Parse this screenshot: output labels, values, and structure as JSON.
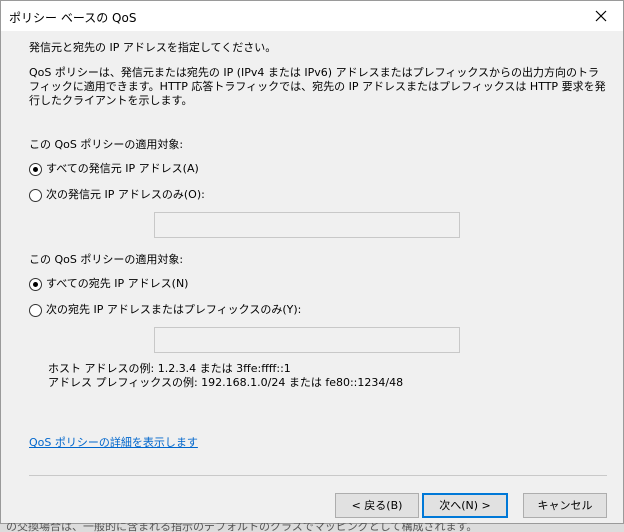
{
  "window": {
    "title": "ポリシー ベースの QoS"
  },
  "intro": "発信元と宛先の IP アドレスを指定してください。",
  "description": "QoS ポリシーは、発信元または宛先の IP (IPv4 または IPv6) アドレスまたはプレフィックスからの出力方向のトラフィックに適用できます。HTTP 応答トラフィックでは、宛先の IP アドレスまたはプレフィックスは HTTP 要求を発行したクライアントを示します。",
  "source": {
    "heading": "この QoS ポリシーの適用対象:",
    "option_all": "すべての発信元 IP アドレス(A)",
    "option_specific": "次の発信元 IP アドレスのみ(O):",
    "value": ""
  },
  "destination": {
    "heading": "この QoS ポリシーの適用対象:",
    "option_all": "すべての宛先 IP アドレス(N)",
    "option_specific": "次の宛先 IP アドレスまたはプレフィックスのみ(Y):",
    "value": ""
  },
  "examples": {
    "host": "ホスト アドレスの例: 1.2.3.4 または 3ffe:ffff::1",
    "prefix": "アドレス プレフィックスの例: 192.168.1.0/24 または fe80::1234/48"
  },
  "link": "QoS ポリシーの詳細を表示します",
  "buttons": {
    "back": "< 戻る(B)",
    "next": "次へ(N) >",
    "cancel": "キャンセル"
  },
  "background_text": "の交換場合は、一般的に含まれる指示のデフォルトのクラスでマッピングとして構成されます。"
}
